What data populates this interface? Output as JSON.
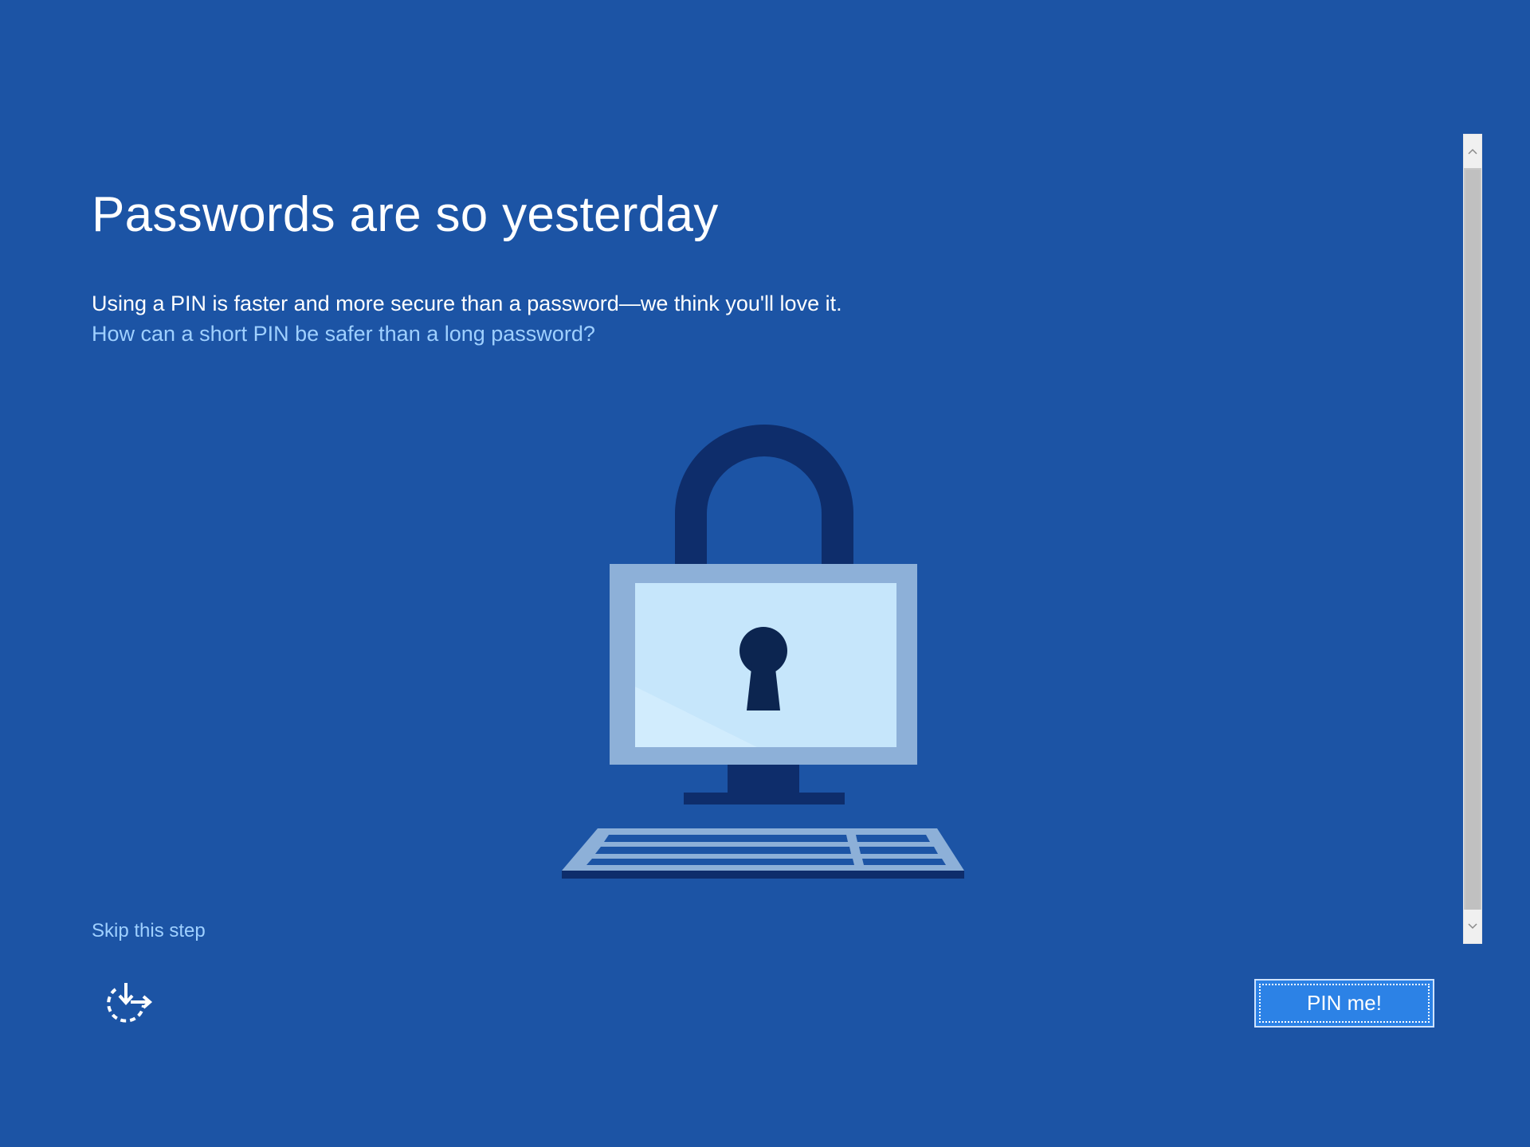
{
  "window": {
    "background_color": "#1c54a5",
    "accent_link_color": "#9fd0ff"
  },
  "header": {
    "title": "Passwords are so yesterday"
  },
  "main": {
    "description": "Using a PIN is faster and more secure than a password—we think you'll love it.",
    "help_link": "How can a short PIN be safer than a long password?",
    "illustration": "padlock-computer-icon"
  },
  "footer": {
    "skip_label": "Skip this step",
    "accessibility_icon": "ease-of-access-icon",
    "primary_button_label": "PIN me!",
    "primary_button_color": "#2c82e6"
  },
  "scrollbar": {
    "up_icon": "chevron-up-icon",
    "down_icon": "chevron-down-icon"
  }
}
